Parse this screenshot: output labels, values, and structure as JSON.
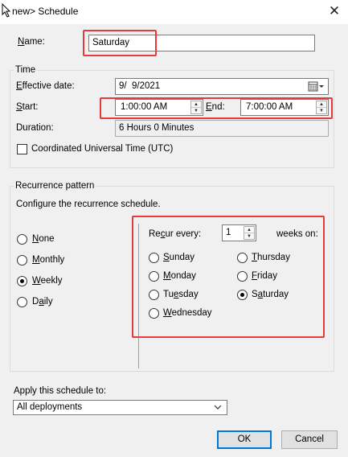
{
  "window": {
    "title": "new> Schedule",
    "close_glyph": "✕"
  },
  "name_field": {
    "label": "Name:",
    "value": "Saturday"
  },
  "time_group": {
    "title": "Time",
    "effective_date_label": "Effective date:",
    "effective_date_value": "9/  9/2021",
    "start_label": "Start:",
    "start_value": "1:00:00 AM",
    "end_label": "End:",
    "end_value": "7:00:00 AM",
    "duration_label": "Duration:",
    "duration_value": "6 Hours 0 Minutes",
    "utc_label": "Coordinated Universal Time (UTC)",
    "utc_checked": false
  },
  "recurrence_group": {
    "title": "Recurrence pattern",
    "description": "Configure the recurrence schedule.",
    "patterns": [
      {
        "label": "None",
        "checked": false
      },
      {
        "label": "Monthly",
        "checked": false
      },
      {
        "label": "Weekly",
        "checked": true
      },
      {
        "label": "Daily",
        "checked": false
      }
    ],
    "recur_every_label": "Recur every:",
    "recur_every_value": "1",
    "weeks_on_label": "weeks on:",
    "days_left": [
      {
        "label": "Sunday",
        "checked": false
      },
      {
        "label": "Monday",
        "checked": false
      },
      {
        "label": "Tuesday",
        "checked": false
      },
      {
        "label": "Wednesday",
        "checked": false
      }
    ],
    "days_right": [
      {
        "label": "Thursday",
        "checked": false
      },
      {
        "label": "Friday",
        "checked": false
      },
      {
        "label": "Saturday",
        "checked": true
      }
    ]
  },
  "apply": {
    "label": "Apply this schedule to:",
    "selected": "All deployments"
  },
  "buttons": {
    "ok": "OK",
    "cancel": "Cancel"
  },
  "colors": {
    "highlight_box": "#e43b3b",
    "default_button_border": "#0078d7"
  }
}
